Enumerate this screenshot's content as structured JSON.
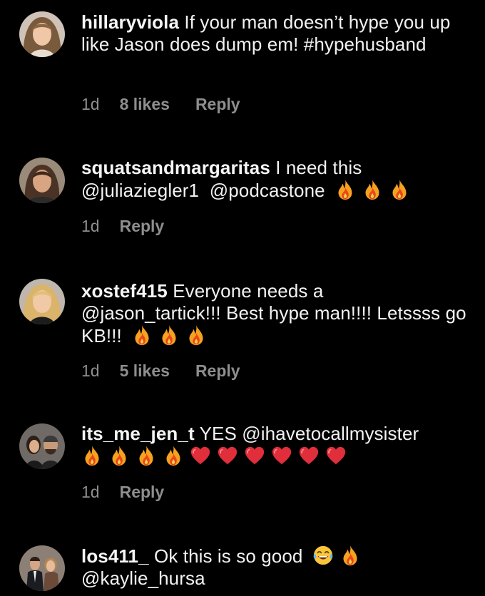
{
  "comments": [
    {
      "username": "hillaryviola",
      "text": "If your man doesn’t hype you up like Jason does dump em! #hypehusband",
      "time": "1d",
      "likes": "8 likes",
      "reply": "Reply"
    },
    {
      "username": "squatsandmargaritas",
      "text": "I need this",
      "mention1": "@juliaziegler1",
      "mention2": "@podcastone",
      "time": "1d",
      "reply": "Reply"
    },
    {
      "username": "xostef415",
      "text": "Everyone needs a",
      "mention": "@jason_tartick",
      "text2": "!!! Best hype man!!!! Letssss go KB!!!",
      "time": "1d",
      "likes": "5 likes",
      "reply": "Reply"
    },
    {
      "username": "its_me_jen_t",
      "text": "YES",
      "mention": "@ihavetocallmysister",
      "time": "1d",
      "reply": "Reply"
    },
    {
      "username": "los411_",
      "text": "Ok this is so good",
      "mention": "@kaylie_hursa"
    }
  ],
  "icons": {
    "fire": "fire-emoji",
    "heart": "red-heart-emoji",
    "laugh": "tears-of-joy-emoji"
  },
  "colors": {
    "background": "#000000",
    "text": "#f2f2f2",
    "meta": "#8e8e8e",
    "fire_outer": "#f5a623",
    "fire_inner": "#e8451e",
    "heart": "#e0303a"
  }
}
